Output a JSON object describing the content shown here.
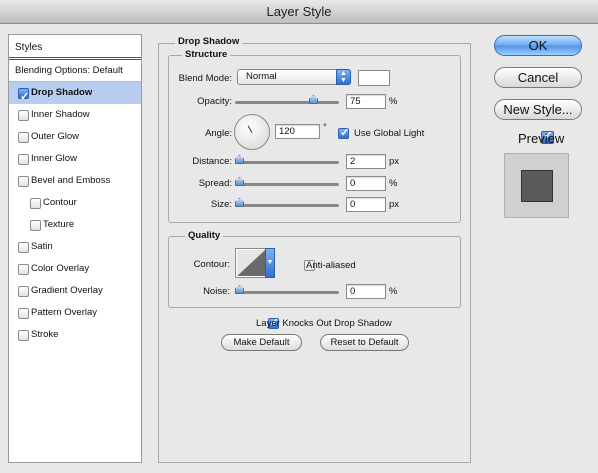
{
  "window": {
    "title": "Layer Style"
  },
  "styles_list": {
    "header": "Styles",
    "blending_options": "Blending Options: Default",
    "items": [
      {
        "label": "Drop Shadow",
        "checked": true,
        "selected": true,
        "indent": 0
      },
      {
        "label": "Inner Shadow",
        "checked": false,
        "selected": false,
        "indent": 0
      },
      {
        "label": "Outer Glow",
        "checked": false,
        "selected": false,
        "indent": 0
      },
      {
        "label": "Inner Glow",
        "checked": false,
        "selected": false,
        "indent": 0
      },
      {
        "label": "Bevel and Emboss",
        "checked": false,
        "selected": false,
        "indent": 0
      },
      {
        "label": "Contour",
        "checked": false,
        "selected": false,
        "indent": 1
      },
      {
        "label": "Texture",
        "checked": false,
        "selected": false,
        "indent": 1
      },
      {
        "label": "Satin",
        "checked": false,
        "selected": false,
        "indent": 0
      },
      {
        "label": "Color Overlay",
        "checked": false,
        "selected": false,
        "indent": 0
      },
      {
        "label": "Gradient Overlay",
        "checked": false,
        "selected": false,
        "indent": 0
      },
      {
        "label": "Pattern Overlay",
        "checked": false,
        "selected": false,
        "indent": 0
      },
      {
        "label": "Stroke",
        "checked": false,
        "selected": false,
        "indent": 0
      }
    ]
  },
  "drop_shadow": {
    "title": "Drop Shadow",
    "structure": {
      "title": "Structure",
      "blend_mode_label": "Blend Mode:",
      "blend_mode_value": "Normal",
      "shadow_color": "#ffffff",
      "opacity_label": "Opacity:",
      "opacity_value": "75",
      "opacity_unit": "%",
      "opacity_level": 0.75,
      "angle_label": "Angle:",
      "angle_value": "120",
      "angle_unit": "°",
      "use_global_light_label": "Use Global Light",
      "use_global_light_checked": true,
      "distance_label": "Distance:",
      "distance_value": "2",
      "distance_unit": "px",
      "spread_label": "Spread:",
      "spread_value": "0",
      "spread_unit": "%",
      "size_label": "Size:",
      "size_value": "0",
      "size_unit": "px"
    },
    "quality": {
      "title": "Quality",
      "contour_label": "Contour:",
      "anti_aliased_label": "Anti-aliased",
      "anti_aliased_checked": false,
      "noise_label": "Noise:",
      "noise_value": "0",
      "noise_unit": "%"
    },
    "knocks_out_label": "Layer Knocks Out Drop Shadow",
    "knocks_out_checked": true,
    "make_default_label": "Make Default",
    "reset_default_label": "Reset to Default"
  },
  "buttons": {
    "ok": "OK",
    "cancel": "Cancel",
    "new_style": "New Style...",
    "preview_label": "Preview",
    "preview_checked": true
  },
  "colors": {
    "accent": "#4e93e6",
    "selected_row": "#b8cdf0",
    "preview_swatch": "#5a5a5a"
  }
}
